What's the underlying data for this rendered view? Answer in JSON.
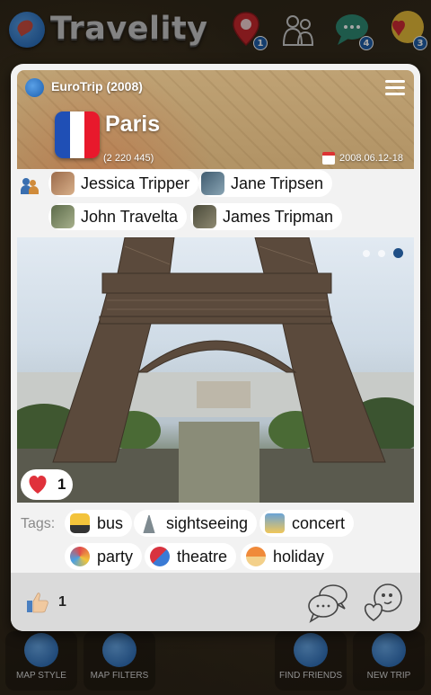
{
  "app": {
    "title": "Travelity"
  },
  "topbar": {
    "icons": [
      {
        "name": "map-pin-icon",
        "badge": "1"
      },
      {
        "name": "friends-icon",
        "badge": ""
      },
      {
        "name": "chat-icon",
        "badge": "4"
      },
      {
        "name": "love-icon",
        "badge": "3"
      }
    ]
  },
  "trip": {
    "name": "EuroTrip (2008)",
    "city": "Paris",
    "population": "(2 220 445)",
    "dates": "2008.06.12-18",
    "flag_colors": [
      "#1f4fb5",
      "#ffffff",
      "#e8192c"
    ],
    "travellers": [
      {
        "name": "Jessica Tripper"
      },
      {
        "name": "Jane Tripsen"
      },
      {
        "name": "John Travelta"
      },
      {
        "name": "James Tripman"
      }
    ]
  },
  "photo": {
    "likes": "1",
    "pages": 3,
    "active_page": 3
  },
  "tags": {
    "label": "Tags:",
    "items": [
      {
        "label": "bus",
        "icon": "bus-icon"
      },
      {
        "label": "sightseeing",
        "icon": "tower-icon"
      },
      {
        "label": "concert",
        "icon": "concert-icon"
      },
      {
        "label": "party",
        "icon": "party-icon"
      },
      {
        "label": "theatre",
        "icon": "theatre-masks-icon"
      },
      {
        "label": "holiday",
        "icon": "beach-icon"
      }
    ]
  },
  "footer": {
    "likes": "1"
  },
  "bottombar": {
    "items": [
      {
        "label": "MAP STYLE"
      },
      {
        "label": "MAP FILTERS"
      },
      {
        "label": "FIND FRIENDS"
      },
      {
        "label": "NEW TRIP"
      }
    ]
  },
  "colors": {
    "accent": "#1f4f86",
    "heart": "#e0313b",
    "card_bg": "#f2f2f2",
    "footer_bg": "#dadada"
  }
}
